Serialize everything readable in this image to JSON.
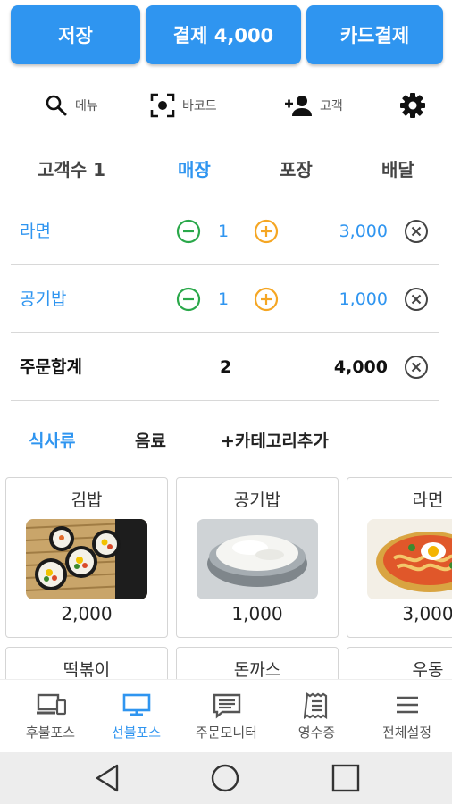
{
  "actions": {
    "save": "저장",
    "pay": "결제 4,000",
    "card_pay": "카드결제"
  },
  "tools": {
    "menu": "메뉴",
    "barcode": "바코드",
    "customer": "고객"
  },
  "order_types": {
    "customers": "고객수 1",
    "dine_in": "매장",
    "takeout": "포장",
    "delivery": "배달"
  },
  "orders": [
    {
      "name": "라면",
      "qty": "1",
      "price": "3,000"
    },
    {
      "name": "공기밥",
      "qty": "1",
      "price": "1,000"
    }
  ],
  "total": {
    "label": "주문합계",
    "qty": "2",
    "price": "4,000"
  },
  "categories": {
    "meal": "식사류",
    "drinks": "음료",
    "add": "+카테고리추가"
  },
  "menu_items": [
    {
      "name": "김밥",
      "price": "2,000"
    },
    {
      "name": "공기밥",
      "price": "1,000"
    },
    {
      "name": "라면",
      "price": "3,000"
    },
    {
      "name": "떡볶이",
      "price": ""
    },
    {
      "name": "돈까스",
      "price": ""
    },
    {
      "name": "우동",
      "price": ""
    }
  ],
  "nav": {
    "postpaid": "후불포스",
    "prepaid": "선불포스",
    "order_monitor": "주문모니터",
    "receipt": "영수증",
    "settings": "전체설정"
  },
  "colors": {
    "accent": "#2f95f0",
    "minus": "#2aa84a",
    "plus": "#f5a623"
  }
}
